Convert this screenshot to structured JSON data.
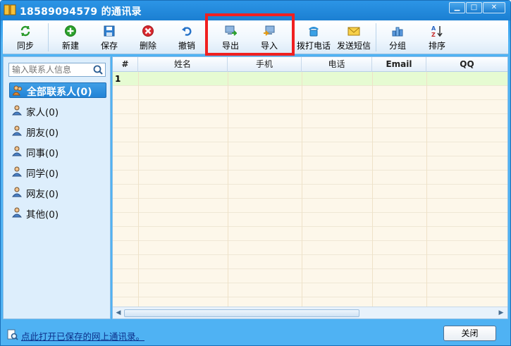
{
  "window": {
    "title": "18589094579  的通讯录"
  },
  "toolbar": {
    "items": [
      {
        "id": "sync",
        "label": "同步",
        "icon": "sync-icon"
      },
      {
        "id": "new",
        "label": "新建",
        "icon": "plus-icon"
      },
      {
        "id": "save",
        "label": "保存",
        "icon": "floppy-icon"
      },
      {
        "id": "delete",
        "label": "删除",
        "icon": "delete-icon"
      },
      {
        "id": "undo",
        "label": "撤销",
        "icon": "undo-icon"
      },
      {
        "id": "export",
        "label": "导出",
        "icon": "export-icon"
      },
      {
        "id": "import",
        "label": "导入",
        "icon": "import-icon"
      },
      {
        "id": "call",
        "label": "拨打电话",
        "icon": "phone-icon"
      },
      {
        "id": "sms",
        "label": "发送短信",
        "icon": "envelope-icon"
      },
      {
        "id": "group",
        "label": "分组",
        "icon": "chart-icon"
      },
      {
        "id": "sort",
        "label": "排序",
        "icon": "sort-az-icon"
      }
    ]
  },
  "search": {
    "placeholder": "输入联系人信息"
  },
  "groups": [
    {
      "label": "全部联系人(0)",
      "active": true
    },
    {
      "label": "家人(0)",
      "active": false
    },
    {
      "label": "朋友(0)",
      "active": false
    },
    {
      "label": "同事(0)",
      "active": false
    },
    {
      "label": "同学(0)",
      "active": false
    },
    {
      "label": "网友(0)",
      "active": false
    },
    {
      "label": "其他(0)",
      "active": false
    }
  ],
  "table": {
    "columns": [
      "#",
      "姓名",
      "手机",
      "电话",
      "Email",
      "QQ"
    ],
    "rows": [
      {
        "num": "1"
      }
    ]
  },
  "footer": {
    "link": "点此打开已保存的网上通讯录。",
    "close_label": "关闭"
  },
  "colors": {
    "accent": "#2283d6",
    "highlight": "#f02020",
    "selected_row": "#e6fbd2",
    "grid_bg": "#fdf7ea"
  }
}
